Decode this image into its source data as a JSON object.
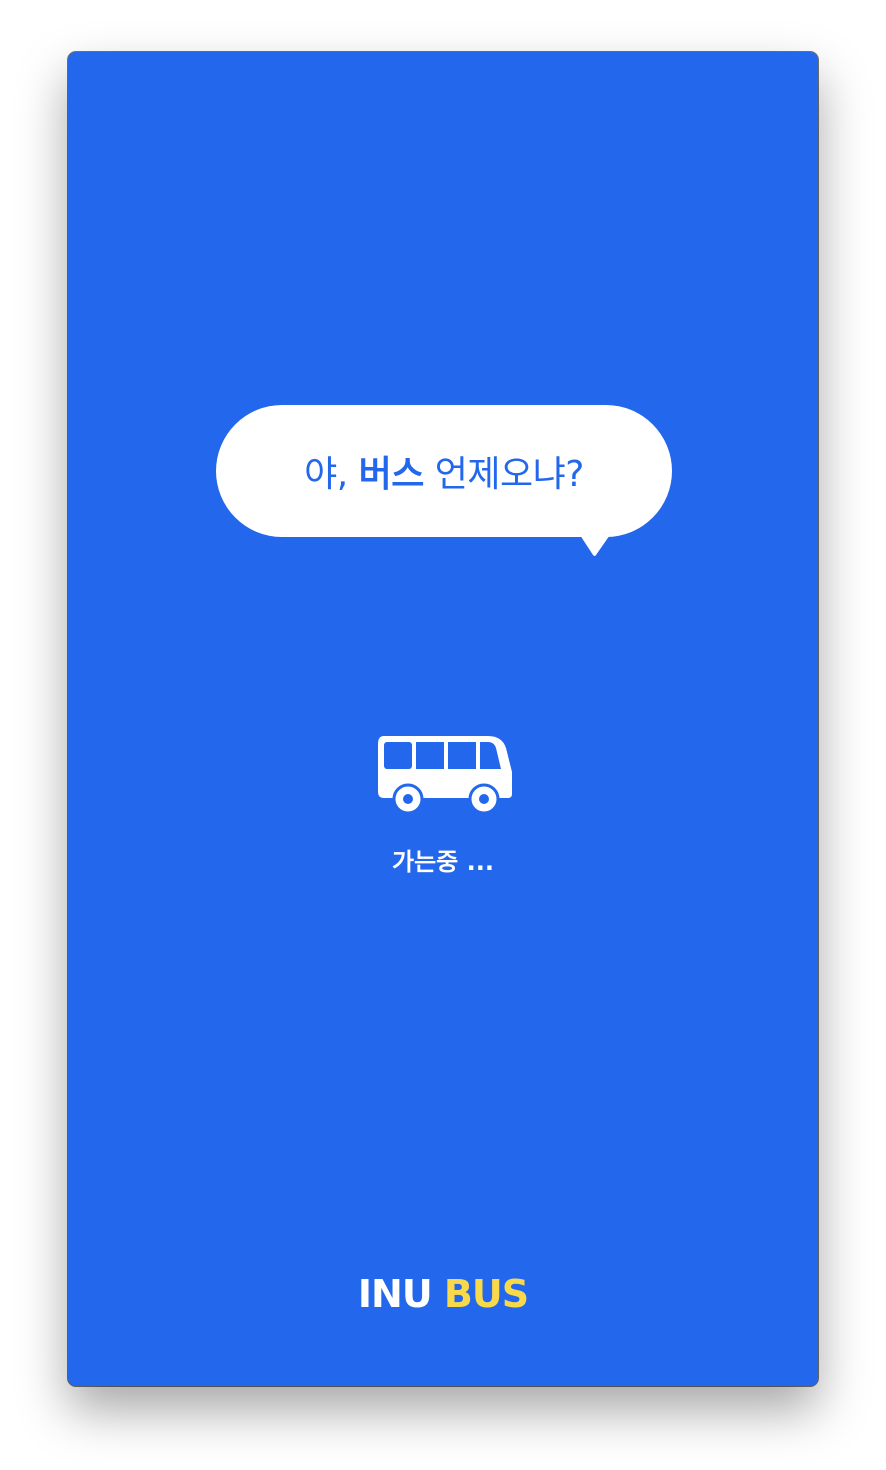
{
  "speech_bubble": {
    "part1": "야, ",
    "part2": "버스",
    "part3": " 언제오냐?"
  },
  "bus_icon": "bus-icon",
  "loading": {
    "text": "가는중 ..."
  },
  "logo": {
    "word1": "INU",
    "word2": "BUS"
  },
  "colors": {
    "background": "#2367ec",
    "bubble": "#ffffff",
    "bubble_text": "#2367ec",
    "logo_accent": "#f8d94a"
  }
}
